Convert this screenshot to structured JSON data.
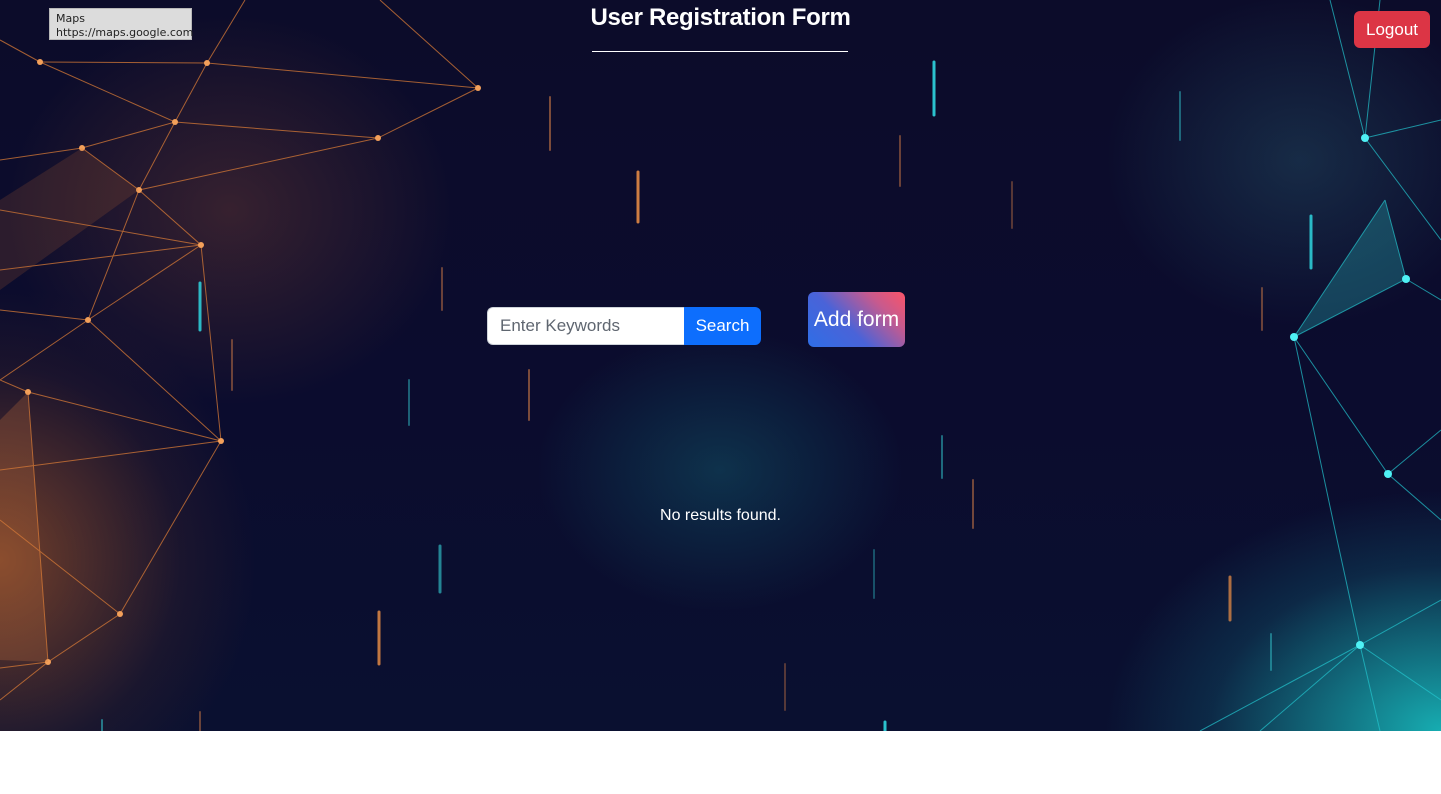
{
  "tooltip": {
    "title": "Maps",
    "url": "https://maps.google.com"
  },
  "header": {
    "title": "User Registration Form",
    "logout_label": "Logout"
  },
  "search": {
    "placeholder": "Enter Keywords",
    "value": "",
    "button_label": "Search"
  },
  "actions": {
    "add_form_label": "Add form"
  },
  "results": {
    "empty_message": "No results found."
  },
  "colors": {
    "logout": "#dc3545",
    "search_button": "#0d6efd",
    "add_form_gradient_start": "#2f6ee6",
    "add_form_gradient_end": "#fb5468",
    "background": "#0c0c2a"
  }
}
